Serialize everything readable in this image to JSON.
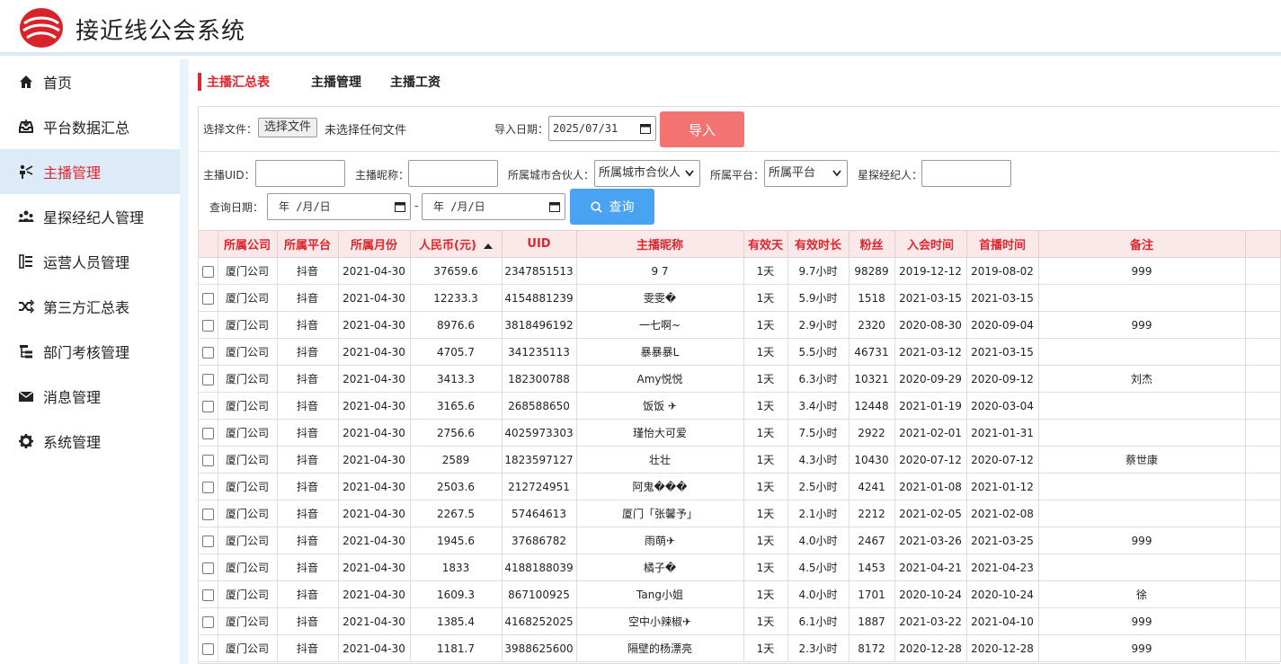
{
  "app": {
    "title": "接近线公会系统",
    "accent": "#e0262d"
  },
  "sidebar": {
    "items": [
      {
        "label": "首页",
        "icon": "home-icon",
        "active": false
      },
      {
        "label": "平台数据汇总",
        "icon": "inbox-icon",
        "active": false
      },
      {
        "label": "主播管理",
        "icon": "presenter-icon",
        "active": true
      },
      {
        "label": "星探经纪人管理",
        "icon": "group-icon",
        "active": false
      },
      {
        "label": "运营人员管理",
        "icon": "list-icon",
        "active": false
      },
      {
        "label": "第三方汇总表",
        "icon": "shuffle-icon",
        "active": false
      },
      {
        "label": "部门考核管理",
        "icon": "tree-icon",
        "active": false
      },
      {
        "label": "消息管理",
        "icon": "envelope-icon",
        "active": false
      },
      {
        "label": "系统管理",
        "icon": "gear-icon",
        "active": false
      }
    ]
  },
  "tabs": [
    {
      "label": "主播汇总表",
      "active": true
    },
    {
      "label": "主播管理",
      "active": false
    },
    {
      "label": "主播工资",
      "active": false
    }
  ],
  "import": {
    "file_label": "选择文件：",
    "file_button": "选择文件",
    "file_status": "未选择任何文件",
    "date_label": "导入日期：",
    "date_value": "2025/07/31",
    "button": "导入"
  },
  "filters": {
    "uid_label": "主播UID：",
    "uid_value": "",
    "nickname_label": "主播昵称：",
    "nickname_value": "",
    "partner_label": "所属城市合伙人：",
    "partner_value": "所属城市合伙人",
    "platform_label": "所属平台：",
    "platform_value": "所属平台",
    "agent_label": "星探经纪人：",
    "agent_value": "",
    "date_label": "查询日期：",
    "date_from": "年 /月/日",
    "date_sep": "-",
    "date_to": "年 /月/日",
    "query_button": "查询"
  },
  "table": {
    "columns": [
      "所属公司",
      "所属平台",
      "所属月份",
      "人民币(元)",
      "UID",
      "主播昵称",
      "有效天",
      "有效时长",
      "粉丝",
      "入会时间",
      "首播时间",
      "备注"
    ],
    "rows": [
      [
        "厦门公司",
        "抖音",
        "2021-04-30",
        "37659.6",
        "2347851513",
        "9 7",
        "1天",
        "9.7小时",
        "98289",
        "2019-12-12",
        "2019-08-02",
        "999"
      ],
      [
        "厦门公司",
        "抖音",
        "2021-04-30",
        "12233.3",
        "4154881239",
        "雯雯�",
        "1天",
        "5.9小时",
        "1518",
        "2021-03-15",
        "2021-03-15",
        ""
      ],
      [
        "厦门公司",
        "抖音",
        "2021-04-30",
        "8976.6",
        "3818496192",
        "一七啊~",
        "1天",
        "2.9小时",
        "2320",
        "2020-08-30",
        "2020-09-04",
        "999"
      ],
      [
        "厦门公司",
        "抖音",
        "2021-04-30",
        "4705.7",
        "341235113",
        "暴暴暴L",
        "1天",
        "5.5小时",
        "46731",
        "2021-03-12",
        "2021-03-15",
        ""
      ],
      [
        "厦门公司",
        "抖音",
        "2021-04-30",
        "3413.3",
        "182300788",
        "Amy悦悦",
        "1天",
        "6.3小时",
        "10321",
        "2020-09-29",
        "2020-09-12",
        "刘杰"
      ],
      [
        "厦门公司",
        "抖音",
        "2021-04-30",
        "3165.6",
        "268588650",
        "饭饭 ✈",
        "1天",
        "3.4小时",
        "12448",
        "2021-01-19",
        "2020-03-04",
        ""
      ],
      [
        "厦门公司",
        "抖音",
        "2021-04-30",
        "2756.6",
        "4025973303",
        "瑾怡大可爱",
        "1天",
        "7.5小时",
        "2922",
        "2021-02-01",
        "2021-01-31",
        ""
      ],
      [
        "厦门公司",
        "抖音",
        "2021-04-30",
        "2589",
        "1823597127",
        "壮壮",
        "1天",
        "4.3小时",
        "10430",
        "2020-07-12",
        "2020-07-12",
        "蔡世康"
      ],
      [
        "厦门公司",
        "抖音",
        "2021-04-30",
        "2503.6",
        "212724951",
        "阿鬼���",
        "1天",
        "2.5小时",
        "4241",
        "2021-01-08",
        "2021-01-12",
        ""
      ],
      [
        "厦门公司",
        "抖音",
        "2021-04-30",
        "2267.5",
        "57464613",
        "厦门「张馨予」",
        "1天",
        "2.1小时",
        "2212",
        "2021-02-05",
        "2021-02-08",
        ""
      ],
      [
        "厦门公司",
        "抖音",
        "2021-04-30",
        "1945.6",
        "37686782",
        "雨萌✈",
        "1天",
        "4.0小时",
        "2467",
        "2021-03-26",
        "2021-03-25",
        "999"
      ],
      [
        "厦门公司",
        "抖音",
        "2021-04-30",
        "1833",
        "4188188039",
        "橘子�",
        "1天",
        "4.5小时",
        "1453",
        "2021-04-21",
        "2021-04-23",
        ""
      ],
      [
        "厦门公司",
        "抖音",
        "2021-04-30",
        "1609.3",
        "867100925",
        "Tang小姐",
        "1天",
        "4.0小时",
        "1701",
        "2020-10-24",
        "2020-10-24",
        "徐"
      ],
      [
        "厦门公司",
        "抖音",
        "2021-04-30",
        "1385.4",
        "4168252025",
        "空中小辣椒✈",
        "1天",
        "6.1小时",
        "1887",
        "2021-03-22",
        "2021-04-10",
        "999"
      ],
      [
        "厦门公司",
        "抖音",
        "2021-04-30",
        "1181.7",
        "3988625600",
        "隔壁的杨漂亮",
        "1天",
        "2.3小时",
        "8172",
        "2020-12-28",
        "2020-12-28",
        "999"
      ]
    ]
  }
}
